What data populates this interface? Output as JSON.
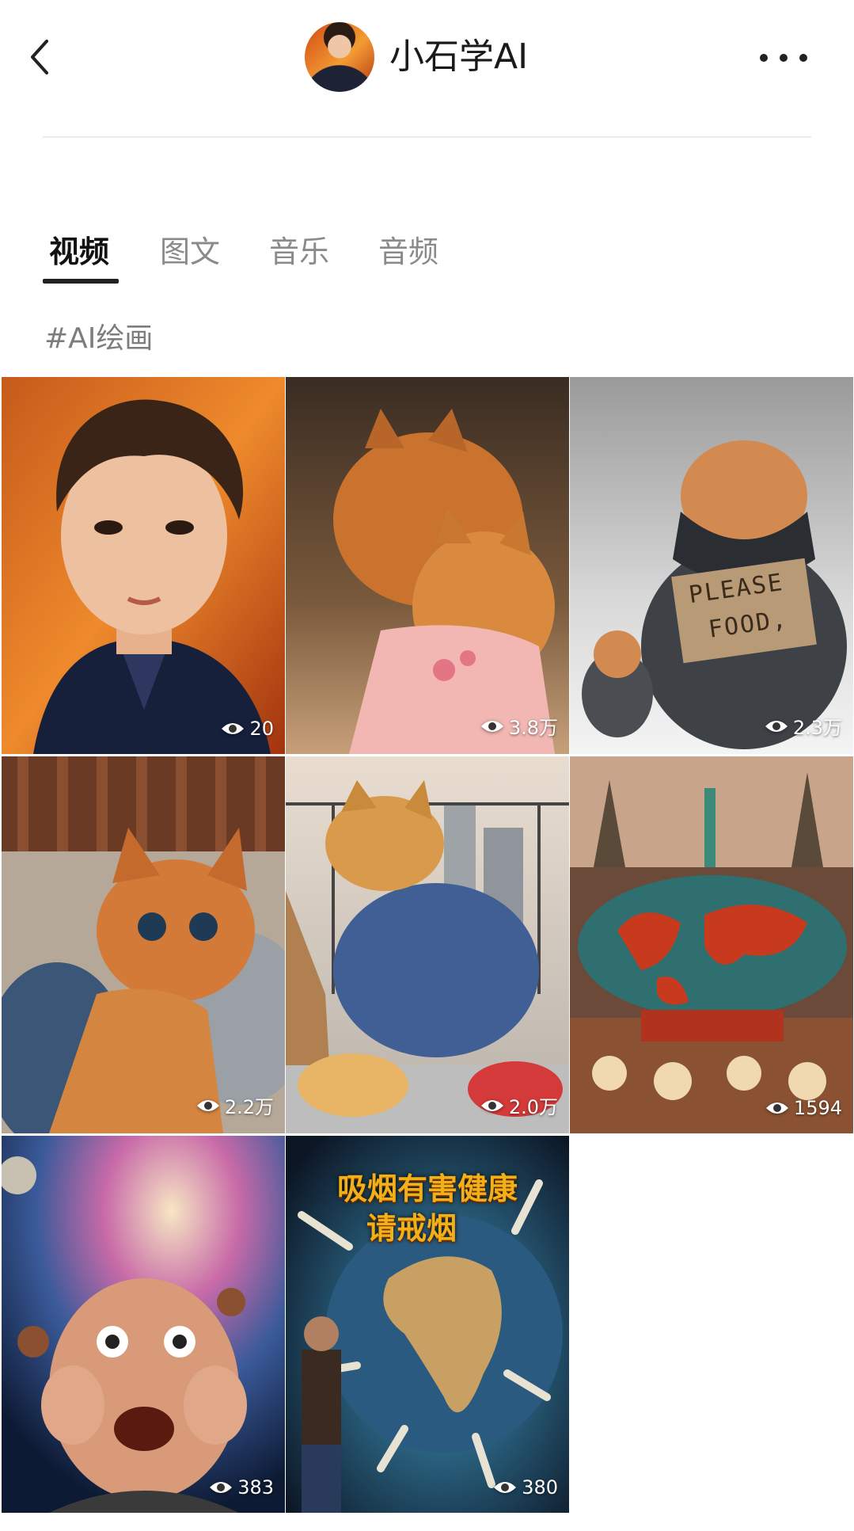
{
  "header": {
    "back_icon": "chevron-left-icon",
    "title": "小石学AI",
    "more_icon": "ellipsis-icon"
  },
  "tabs": [
    {
      "label": "视频",
      "active": true
    },
    {
      "label": "图文",
      "active": false
    },
    {
      "label": "音乐",
      "active": false
    },
    {
      "label": "音频",
      "active": false
    }
  ],
  "hashtag": "#AI绘画",
  "grid": {
    "items": [
      {
        "views": "20"
      },
      {
        "views": "3.8万"
      },
      {
        "views": "2.3万",
        "sign_line1": "PLEASE",
        "sign_line2": "FOOD,"
      },
      {
        "views": "2.2万"
      },
      {
        "views": "2.0万"
      },
      {
        "views": "1594"
      },
      {
        "views": "383"
      },
      {
        "views": "380",
        "caption_line1": "吸烟有害健康",
        "caption_line2": "请戒烟"
      }
    ]
  },
  "colors": {
    "accent_text": "#111111",
    "inactive_tab": "#8a8a8a",
    "hashtag": "#7d7d7d"
  }
}
